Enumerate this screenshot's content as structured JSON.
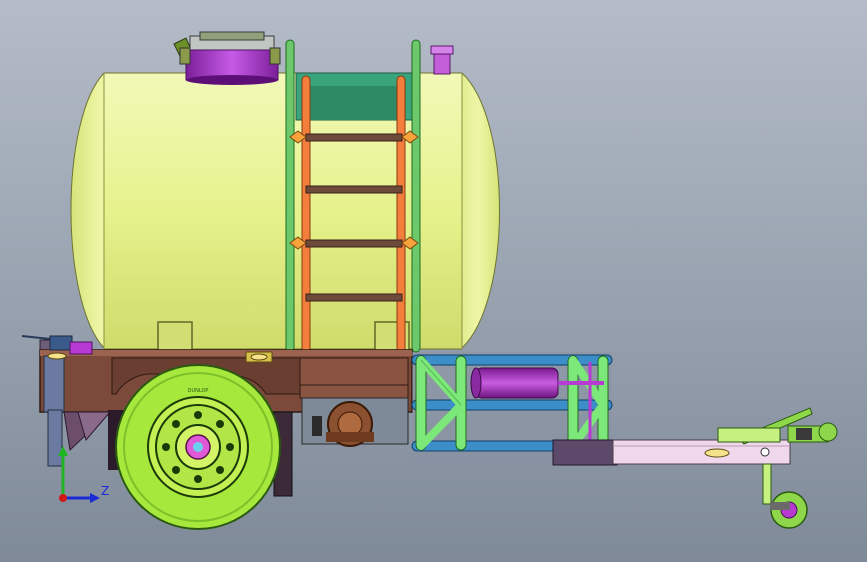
{
  "viewport": {
    "background_top": "#b4bcc8",
    "background_bottom": "#7f8a99"
  },
  "axis_triad": {
    "z_label": "Z",
    "z_color": "#1a2bd6",
    "y_color": "#1fb51f",
    "origin_color": "#d21818"
  },
  "colors": {
    "tank": "#e6f28c",
    "ladder_rails": "#f47f3c",
    "ladder_rungs": "#6e4a3a",
    "frame": "#7b4a3a",
    "tyre": "#a6e83c",
    "pipe_green": "#7de87a",
    "pipe_blue": "#3b8ec8",
    "hatch": "#b73ad2",
    "drawbar": "#f0d8ec",
    "jack_wheel": "#8ed64a"
  },
  "tyre_text": "DUNLOP"
}
